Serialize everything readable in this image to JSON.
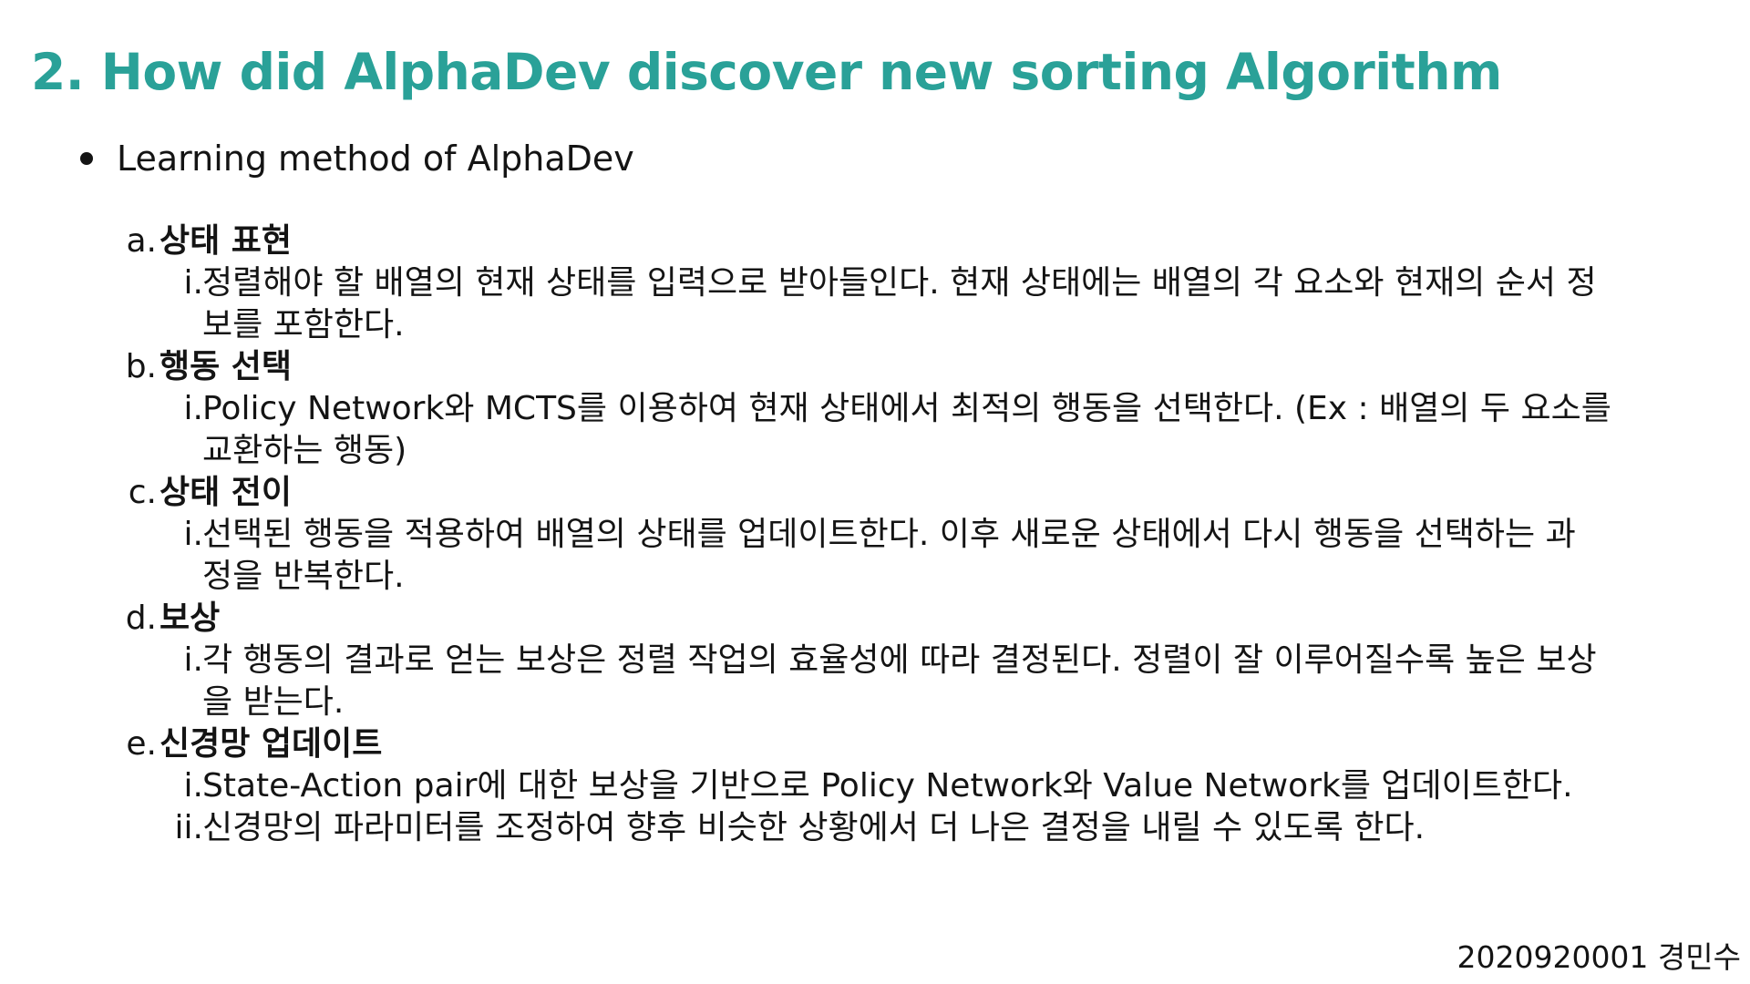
{
  "title": "2. How did AlphaDev discover new sorting Algorithm",
  "bullet": "Learning method of AlphaDev",
  "sections": [
    {
      "letter": "a.",
      "title": "상태 표현",
      "items": [
        {
          "num": "i.",
          "text": "정렬해야 할 배열의 현재 상태를 입력으로 받아들인다. 현재 상태에는 배열의 각 요소와 현재의 순서 정\n보를 포함한다."
        }
      ]
    },
    {
      "letter": "b.",
      "title": "행동 선택",
      "items": [
        {
          "num": "i.",
          "text": "Policy Network와 MCTS를 이용하여 현재 상태에서 최적의 행동을 선택한다. (Ex : 배열의 두 요소를\n교환하는 행동)"
        }
      ]
    },
    {
      "letter": "c.",
      "title": "상태 전이",
      "items": [
        {
          "num": "i.",
          "text": "선택된 행동을 적용하여 배열의 상태를 업데이트한다. 이후 새로운 상태에서 다시 행동을 선택하는 과\n정을 반복한다."
        }
      ]
    },
    {
      "letter": "d.",
      "title": "보상",
      "items": [
        {
          "num": "i.",
          "text": "각 행동의 결과로 얻는 보상은 정렬 작업의 효율성에 따라 결정된다. 정렬이 잘 이루어질수록 높은 보상\n을 받는다."
        }
      ]
    },
    {
      "letter": "e.",
      "title": "신경망 업데이트",
      "items": [
        {
          "num": "i.",
          "text": "State-Action pair에 대한 보상을 기반으로 Policy Network와 Value Network를 업데이트한다."
        },
        {
          "num": "ii.",
          "text": "신경망의 파라미터를 조정하여 향후 비슷한 상황에서 더 나은 결정을 내릴 수 있도록 한다."
        }
      ]
    }
  ],
  "footer": "2020920001 경민수",
  "colors": {
    "title": "#2aa198",
    "text": "#141414",
    "background": "#ffffff"
  }
}
